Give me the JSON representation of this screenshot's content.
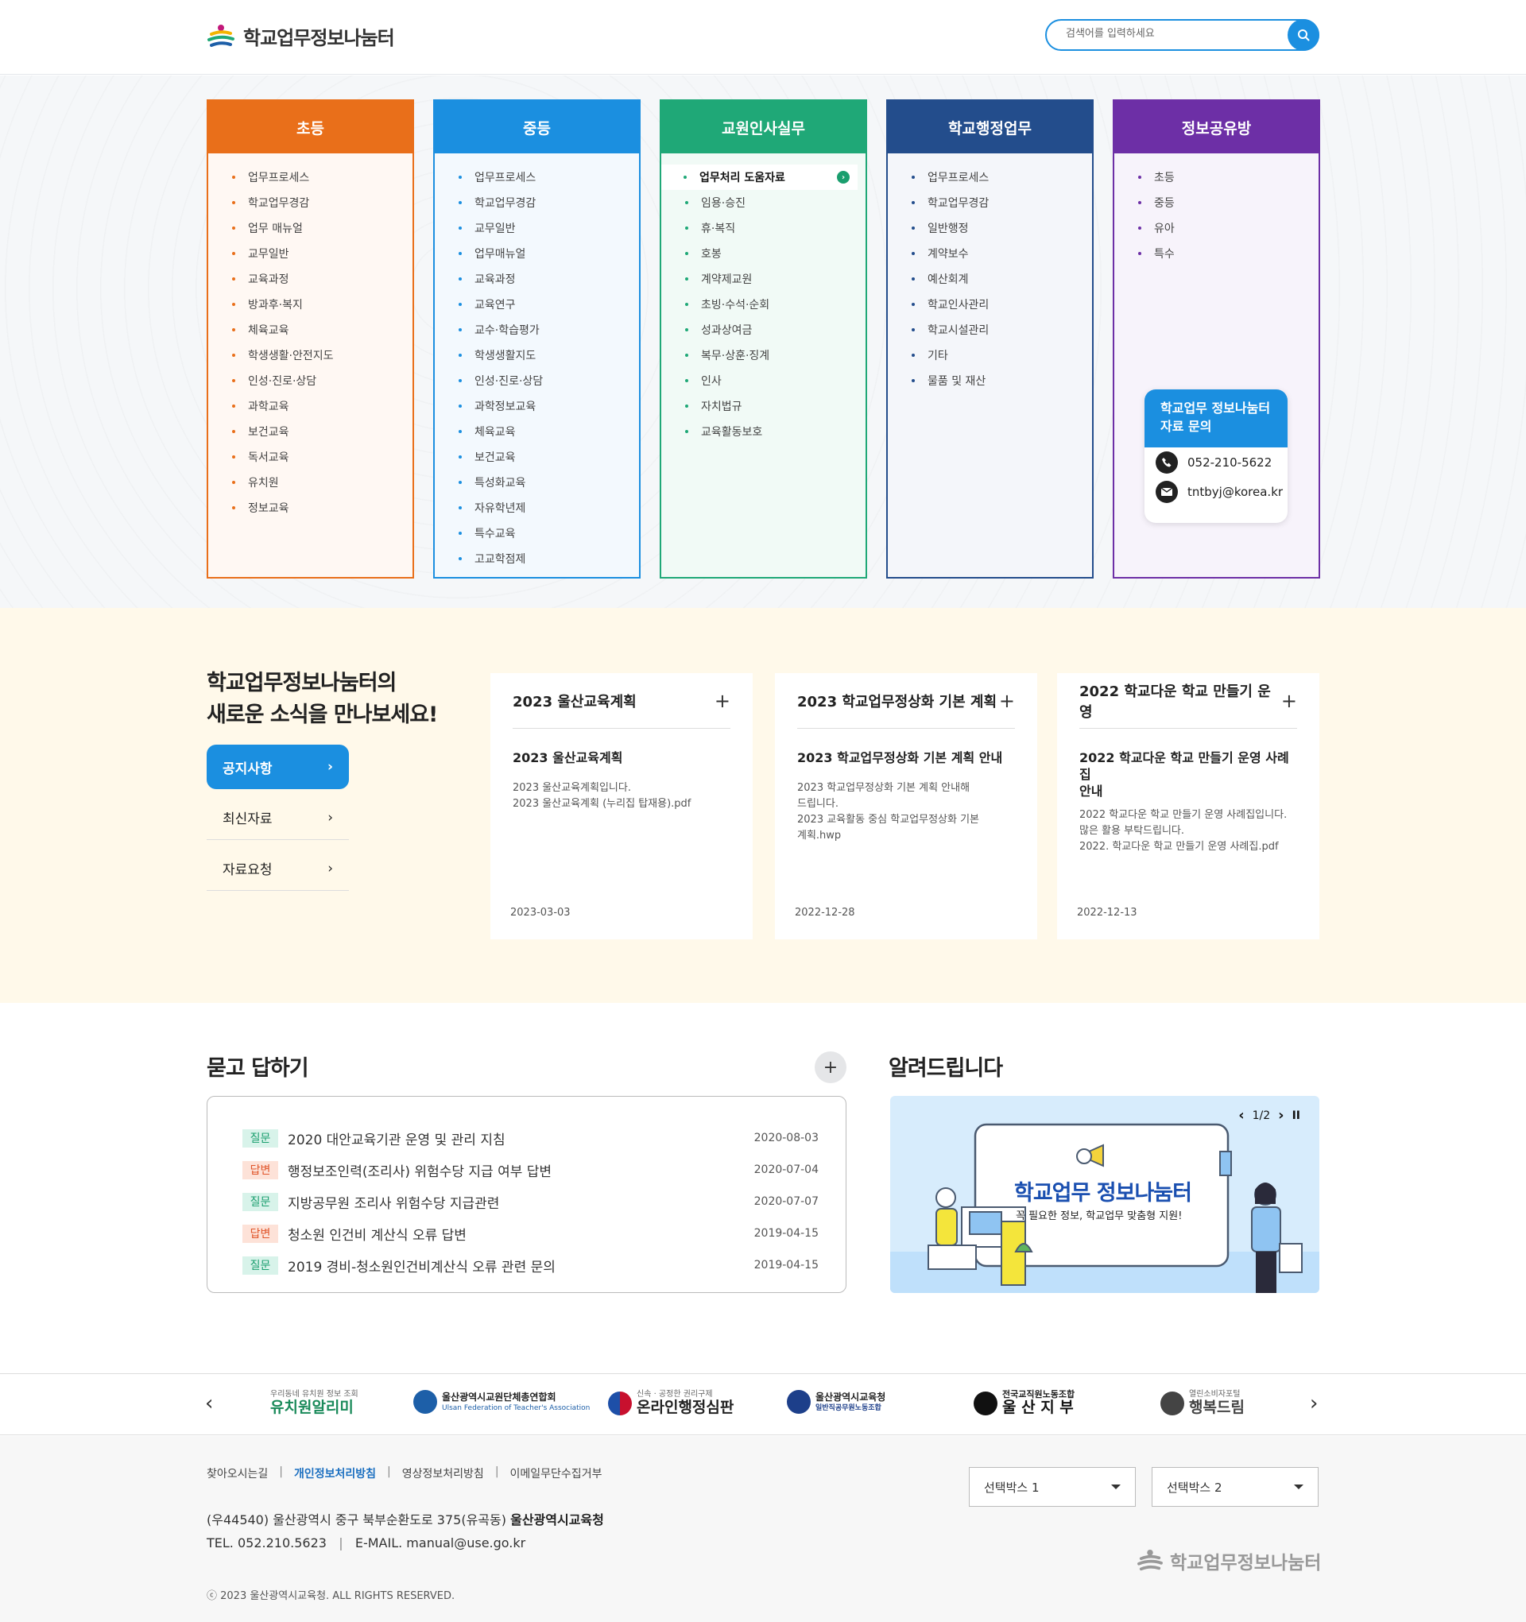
{
  "header": {
    "logo_text": "학교업무정보나눔터",
    "search_placeholder": "검색어를 입력하세요"
  },
  "menu": [
    {
      "title": "초등",
      "color": "#e96f1a",
      "bg": "#fff8f3",
      "dot": "#e96f1a",
      "items": [
        "업무프로세스",
        "학교업무경감",
        "업무 매뉴얼",
        "교무일반",
        "교육과정",
        "방과후·복지",
        "체육교육",
        "학생생활·안전지도",
        "인성·진로·상담",
        "과학교육",
        "보건교육",
        "독서교육",
        "유치원",
        "정보교육"
      ]
    },
    {
      "title": "중등",
      "color": "#1b8fe0",
      "bg": "#f3f9fe",
      "dot": "#1b8fe0",
      "items": [
        "업무프로세스",
        "학교업무경감",
        "교무일반",
        "업무매뉴얼",
        "교육과정",
        "교육연구",
        "교수·학습평가",
        "학생생활지도",
        "인성·진로·상담",
        "과학정보교육",
        "체육교육",
        "보건교육",
        "특성화교육",
        "자유학년제",
        "특수교육",
        "고교학점제"
      ]
    },
    {
      "title": "교원인사실무",
      "color": "#1fa877",
      "bg": "#f1faf6",
      "dot": "#1fa877",
      "items": [
        "업무처리 도움자료",
        "임용·승진",
        "휴·복직",
        "호봉",
        "계약제교원",
        "초빙·수석·순회",
        "성과상여금",
        "복무·상훈·징계",
        "인사",
        "자치법규",
        "교육활동보호"
      ]
    },
    {
      "title": "학교행정업무",
      "color": "#234d8c",
      "bg": "#f4f6fa",
      "dot": "#234d8c",
      "items": [
        "업무프로세스",
        "학교업무경감",
        "일반행정",
        "계약보수",
        "예산회계",
        "학교인사관리",
        "학교시설관리",
        "기타",
        "물품 및 재산"
      ]
    },
    {
      "title": "정보공유방",
      "color": "#6d2fa6",
      "bg": "#f7f3fb",
      "dot": "#6d2fa6",
      "items": [
        "초등",
        "중등",
        "유아",
        "특수"
      ]
    }
  ],
  "contact": {
    "title": "학교업무 정보나눔터 자료 문의",
    "phone": "052-210-5622",
    "email": "tntbyj@korea.kr"
  },
  "news": {
    "heading_line1": "학교업무정보나눔터의",
    "heading_line2": "새로운 소식을 만나보세요!",
    "tabs": [
      "공지사항",
      "최신자료",
      "자료요청"
    ],
    "cards": [
      {
        "title": "2023 울산교육계획",
        "subtitle": "2023 울산교육계획",
        "desc": "2023 울산교육계획입니다.\n2023 울산교육계획 (누리집 탑재용).pdf",
        "date": "2023-03-03"
      },
      {
        "title": "2023 학교업무정상화 기본 계획",
        "subtitle": "2023 학교업무정상화 기본 계획 안내",
        "desc": "2023 학교업무정상화 기본 계획 안내해\n드립니다.\n2023 교육활동 중심 학교업무정상화 기본\n계획.hwp",
        "date": "2022-12-28"
      },
      {
        "title": "2022 학교다운 학교 만들기 운영",
        "subtitle": "2022 학교다운 학교 만들기 운영 사례집\n안내",
        "desc": "2022 학교다운 학교 만들기 운영 사례집입니다.\n많은 활용 부탁드립니다.\n2022. 학교다운 학교 만들기 운영 사례집.pdf",
        "date": "2022-12-13"
      }
    ]
  },
  "qna": {
    "title": "묻고 답하기",
    "rows": [
      {
        "type": "질문",
        "kind": "q",
        "text": "2020 대안교육기관 운영 및 관리 지침",
        "date": "2020-08-03"
      },
      {
        "type": "답변",
        "kind": "a",
        "text": "행정보조인력(조리사) 위험수당 지급 여부 답변",
        "date": "2020-07-04"
      },
      {
        "type": "질문",
        "kind": "q",
        "text": "지방공무원 조리사 위험수당 지급관련",
        "date": "2020-07-07"
      },
      {
        "type": "답변",
        "kind": "a",
        "text": "청소원 인건비 계산식 오류 답변",
        "date": "2019-04-15"
      },
      {
        "type": "질문",
        "kind": "q",
        "text": "2019 경비-청소원인건비계산식 오류 관련 문의",
        "date": "2019-04-15"
      }
    ]
  },
  "notice": {
    "title": "알려드립니다",
    "pager": "1/2",
    "banner_title": "학교업무 정보나눔터",
    "banner_sub": "꼭 필요한 정보, 학교업무 맞춤형 지원!"
  },
  "partners": [
    {
      "top": "우리동네 유치원 정보 조회",
      "main": "유치원알리미",
      "color": "#1a8a5a"
    },
    {
      "top": "울산광역시교원단체총연합회",
      "main": "Ulsan Federation of Teacher's Association",
      "color": "#1d5fa8"
    },
    {
      "top": "신속 · 공정한 권리구제",
      "main": "온라인행정심판",
      "color": "#222"
    },
    {
      "top": "울산광역시교육청",
      "main": "일반직공무원노동조합",
      "color": "#1d3f8a"
    },
    {
      "top": "전국교직원노동조합",
      "main": "울 산 지 부",
      "color": "#111"
    },
    {
      "top": "열린소비자포털",
      "main": "행복드림",
      "color": "#444"
    }
  ],
  "footer": {
    "links": [
      "찾아오시는길",
      "개인정보처리방침",
      "영상정보처리방침",
      "이메일무단수집거부"
    ],
    "select1": "선택박스 1",
    "select2": "선택박스 2",
    "address": "(우44540) 울산광역시 중구 북부순환도로 375(유곡동)",
    "org": "울산광역시교육청",
    "tel": "TEL. 052.210.5623",
    "email": "E-MAIL. manual@use.go.kr",
    "copyright": "ⓒ 2023 울산광역시교육청. ALL RIGHTS RESERVED.",
    "logo_text": "학교업무정보나눔터"
  }
}
